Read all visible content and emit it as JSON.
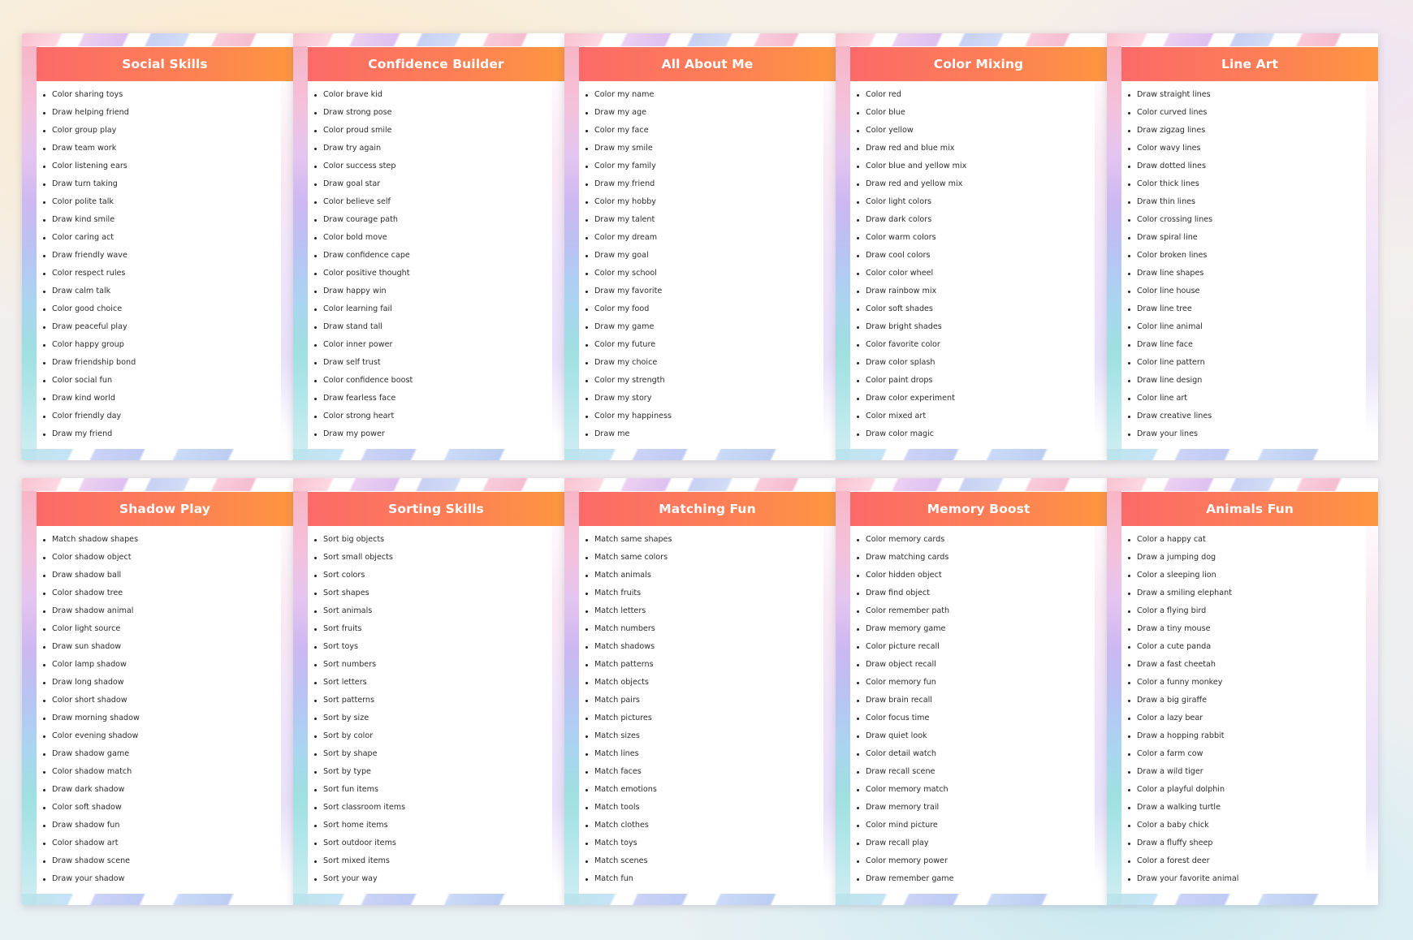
{
  "cards": [
    {
      "title": "Social Skills",
      "items": [
        "Color sharing toys",
        "Draw helping friend",
        "Color group play",
        "Draw team work",
        "Color listening ears",
        "Draw turn taking",
        "Color polite talk",
        "Draw kind smile",
        "Color caring act",
        "Draw friendly wave",
        "Color respect rules",
        "Draw calm talk",
        "Color good choice",
        "Draw peaceful play",
        "Color happy group",
        "Draw friendship bond",
        "Color social fun",
        "Draw kind world",
        "Color friendly day",
        "Draw my friend"
      ]
    },
    {
      "title": "Confidence Builder",
      "items": [
        "Color brave kid",
        "Draw strong pose",
        "Color proud smile",
        "Draw try again",
        "Color success step",
        "Draw goal star",
        "Color believe self",
        "Draw courage path",
        "Color bold move",
        "Draw confidence cape",
        "Color positive thought",
        "Draw happy win",
        "Color learning fail",
        "Draw stand tall",
        "Color inner power",
        "Draw self trust",
        "Color confidence boost",
        "Draw fearless face",
        "Color strong heart",
        "Draw my power"
      ]
    },
    {
      "title": "All About Me",
      "items": [
        "Color my name",
        "Draw my age",
        "Color my face",
        "Draw my smile",
        "Color my family",
        "Draw my friend",
        "Color my hobby",
        "Draw my talent",
        "Color my dream",
        "Draw my goal",
        "Color my school",
        "Draw my favorite",
        "Color my food",
        "Draw my game",
        "Color my future",
        "Draw my choice",
        "Color my strength",
        "Draw my story",
        "Color my happiness",
        "Draw me"
      ]
    },
    {
      "title": "Color Mixing",
      "items": [
        "Color red",
        "Color blue",
        "Color yellow",
        "Draw red and blue mix",
        "Color blue and yellow mix",
        "Draw red and yellow mix",
        "Color light colors",
        "Draw dark colors",
        "Color warm colors",
        "Draw cool colors",
        "Color color wheel",
        "Draw rainbow mix",
        "Color soft shades",
        "Draw bright shades",
        "Color favorite color",
        "Draw color splash",
        "Color paint drops",
        "Draw color experiment",
        "Color mixed art",
        "Draw color magic"
      ]
    },
    {
      "title": "Line Art",
      "items": [
        "Draw straight lines",
        "Color curved lines",
        "Draw zigzag lines",
        "Color wavy lines",
        "Draw dotted lines",
        "Color thick lines",
        "Draw thin lines",
        "Color crossing lines",
        "Draw spiral line",
        "Color broken lines",
        "Draw line shapes",
        "Color line house",
        "Draw line tree",
        "Color line animal",
        "Draw line face",
        "Color line pattern",
        "Draw line design",
        "Color line art",
        "Draw creative lines",
        "Draw your lines"
      ]
    },
    {
      "title": "Shadow Play",
      "items": [
        "Match shadow shapes",
        "Color shadow object",
        "Draw shadow ball",
        "Color shadow tree",
        "Draw shadow animal",
        "Color light source",
        "Draw sun shadow",
        "Color lamp shadow",
        "Draw long shadow",
        "Color short shadow",
        "Draw morning shadow",
        "Color evening shadow",
        "Draw shadow game",
        "Color shadow match",
        "Draw dark shadow",
        "Color soft shadow",
        "Draw shadow fun",
        "Color shadow art",
        "Draw shadow scene",
        "Draw your shadow"
      ]
    },
    {
      "title": "Sorting Skills",
      "items": [
        "Sort big objects",
        "Sort small objects",
        "Sort colors",
        "Sort shapes",
        "Sort animals",
        "Sort fruits",
        "Sort toys",
        "Sort numbers",
        "Sort letters",
        "Sort patterns",
        "Sort by size",
        "Sort by color",
        "Sort by shape",
        "Sort by type",
        "Sort fun items",
        "Sort classroom items",
        "Sort home items",
        "Sort outdoor items",
        "Sort mixed items",
        "Sort your way"
      ]
    },
    {
      "title": "Matching Fun",
      "items": [
        "Match same shapes",
        "Match same colors",
        "Match animals",
        "Match fruits",
        "Match letters",
        "Match numbers",
        "Match shadows",
        "Match patterns",
        "Match objects",
        "Match pairs",
        "Match pictures",
        "Match sizes",
        "Match lines",
        "Match faces",
        "Match emotions",
        "Match tools",
        "Match clothes",
        "Match toys",
        "Match scenes",
        "Match fun"
      ]
    },
    {
      "title": "Memory Boost",
      "items": [
        "Color memory cards",
        "Draw matching cards",
        "Color hidden object",
        "Draw find object",
        "Color remember path",
        "Draw memory game",
        "Color picture recall",
        "Draw object recall",
        "Color memory fun",
        "Draw brain recall",
        "Color focus time",
        "Draw quiet look",
        "Color detail watch",
        "Draw recall scene",
        "Color memory match",
        "Draw memory trail",
        "Color mind picture",
        "Draw recall play",
        "Color memory power",
        "Draw remember game"
      ]
    },
    {
      "title": "Animals Fun",
      "items": [
        "Color a happy cat",
        "Draw a jumping dog",
        "Color a sleeping lion",
        "Draw a smiling elephant",
        "Color a flying bird",
        "Draw a tiny mouse",
        "Color a cute panda",
        "Draw a fast cheetah",
        "Color a funny monkey",
        "Draw a big giraffe",
        "Color a lazy bear",
        "Draw a hopping rabbit",
        "Color a farm cow",
        "Draw a wild tiger",
        "Color a playful dolphin",
        "Draw a walking turtle",
        "Color a baby chick",
        "Draw a fluffy sheep",
        "Color a forest deer",
        "Draw your favorite animal"
      ]
    }
  ]
}
